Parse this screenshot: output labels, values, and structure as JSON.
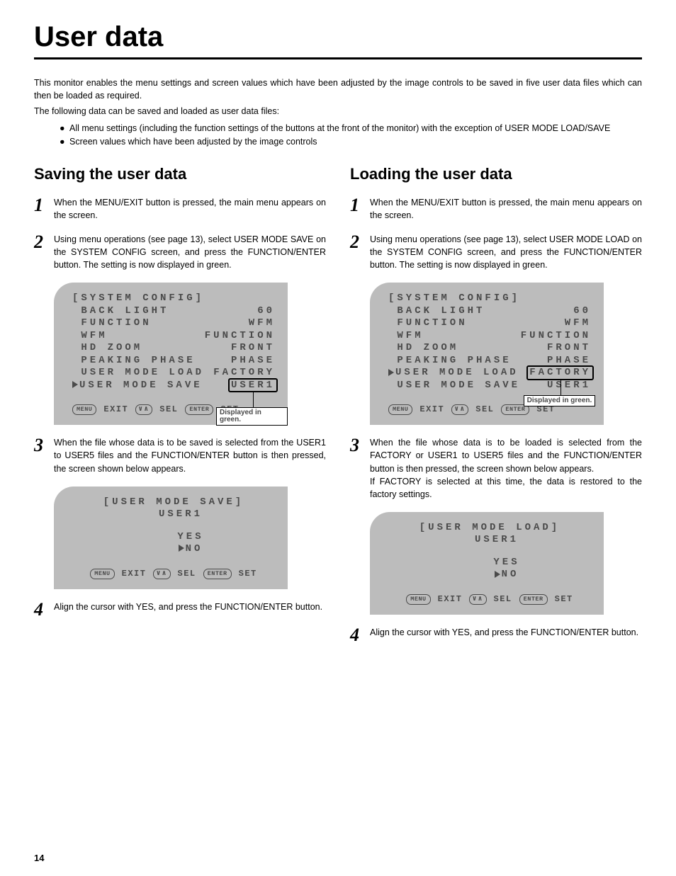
{
  "title": "User data",
  "intro1": "This monitor enables the menu settings and screen values which have been adjusted by the image controls to be saved in five user data files which can then be loaded as required.",
  "intro2": "The following data can be saved and loaded as user data files:",
  "bullet1": "All menu settings (including the function settings of the buttons at the front of the monitor) with the exception of USER MODE LOAD/SAVE",
  "bullet2": "Screen values which have been adjusted by the image controls",
  "save": {
    "title": "Saving the user data",
    "step1": "When the MENU/EXIT button is pressed, the main menu appears on the screen.",
    "step2": "Using menu operations (see page 13), select USER MODE SAVE on the SYSTEM CONFIG screen, and press the FUNCTION/ENTER button.  The setting is now displayed in green.",
    "step3": "When the file whose data is to be saved is selected from the USER1 to USER5 files and the FUNCTION/ENTER button is then pressed, the screen shown below appears.",
    "step4": "Align the cursor with YES, and press the FUNCTION/ENTER button.",
    "osd1": {
      "header": "[SYSTEM CONFIG]",
      "rows": [
        {
          "l": "BACK LIGHT",
          "r": "60"
        },
        {
          "l": "FUNCTION",
          "r": "WFM"
        },
        {
          "l": "WFM",
          "r": "FUNCTION"
        },
        {
          "l": "HD ZOOM",
          "r": "FRONT"
        },
        {
          "l": "PEAKING PHASE",
          "r": "PHASE"
        },
        {
          "l": "USER MODE LOAD",
          "r": "FACTORY"
        },
        {
          "l": "USER MODE SAVE",
          "r": "USER1",
          "cursor": true,
          "box": true
        }
      ],
      "footer": {
        "menu": "MENU",
        "exit": "EXIT",
        "sel": "SEL",
        "enter": "ENTER",
        "set": "SET"
      },
      "callout": "Displayed in green."
    },
    "osd2": {
      "header": "[USER MODE SAVE]",
      "sub": "USER1",
      "yes": "YES",
      "no": "NO",
      "footer": {
        "menu": "MENU",
        "exit": "EXIT",
        "sel": "SEL",
        "enter": "ENTER",
        "set": "SET"
      }
    }
  },
  "load": {
    "title": "Loading the user data",
    "step1": "When the MENU/EXIT button is pressed, the main menu appears on the screen.",
    "step2": "Using menu operations (see page 13), select USER MODE LOAD on the SYSTEM CONFIG screen, and press the FUNCTION/ENTER button.  The setting is now displayed in green.",
    "step3": "When the file whose data is to be loaded is selected from the FACTORY or USER1 to USER5 files and the FUNCTION/ENTER button is then pressed, the screen shown below appears.",
    "step3b": "If FACTORY is selected at this time, the data is restored to the factory settings.",
    "step4": "Align the cursor with YES, and press the FUNCTION/ENTER button.",
    "osd1": {
      "header": "[SYSTEM CONFIG]",
      "rows": [
        {
          "l": "BACK LIGHT",
          "r": "60"
        },
        {
          "l": "FUNCTION",
          "r": "WFM"
        },
        {
          "l": "WFM",
          "r": "FUNCTION"
        },
        {
          "l": "HD ZOOM",
          "r": "FRONT"
        },
        {
          "l": "PEAKING PHASE",
          "r": "PHASE"
        },
        {
          "l": "USER MODE LOAD",
          "r": "FACTORY",
          "cursor": true,
          "box": true
        },
        {
          "l": "USER MODE SAVE",
          "r": "USER1"
        }
      ],
      "footer": {
        "menu": "MENU",
        "exit": "EXIT",
        "sel": "SEL",
        "enter": "ENTER",
        "set": "SET"
      },
      "callout": "Displayed in green."
    },
    "osd2": {
      "header": "[USER MODE LOAD]",
      "sub": "USER1",
      "yes": "YES",
      "no": "NO",
      "footer": {
        "menu": "MENU",
        "exit": "EXIT",
        "sel": "SEL",
        "enter": "ENTER",
        "set": "SET"
      }
    }
  },
  "pageNumber": "14"
}
